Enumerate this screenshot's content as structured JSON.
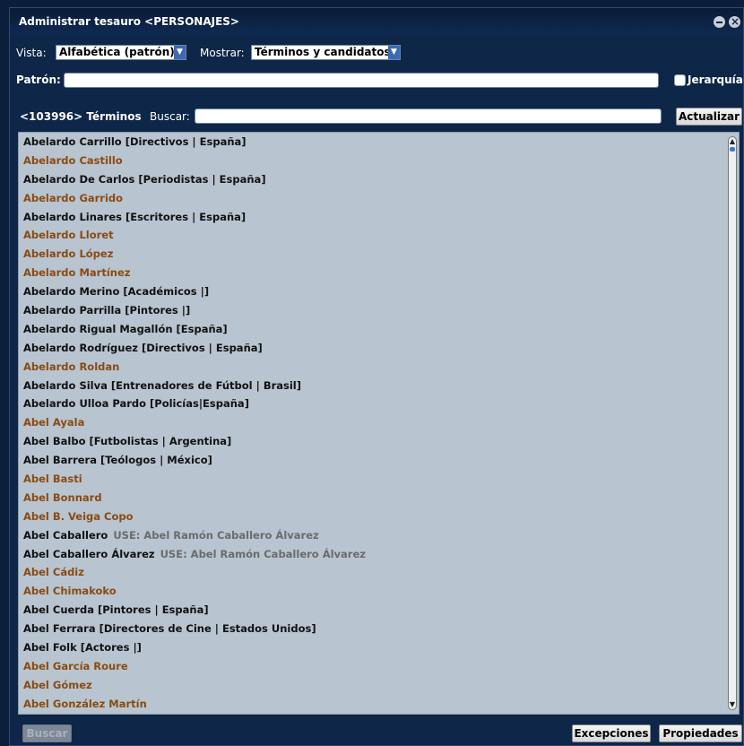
{
  "window": {
    "title": "Administrar tesauro <PERSONAJES>"
  },
  "controls": {
    "vista_label": "Vista:",
    "vista_value": "Alfabética (patrón)",
    "mostrar_label": "Mostrar:",
    "mostrar_value": "Términos y candidatos",
    "patron_label": "Patrón:",
    "patron_value": "",
    "jerarquia_label": "Jerarquía",
    "count_label": "<103996> Términos",
    "buscar_label": "Buscar:",
    "buscar_value": "",
    "actualizar": "Actualizar"
  },
  "terms": [
    {
      "text": "Abelardo Carrillo [Directivos | España]",
      "kind": "term",
      "use": ""
    },
    {
      "text": "Abelardo Castillo",
      "kind": "cand",
      "use": ""
    },
    {
      "text": "Abelardo De Carlos [Periodistas | España]",
      "kind": "term",
      "use": ""
    },
    {
      "text": "Abelardo Garrido",
      "kind": "cand",
      "use": ""
    },
    {
      "text": "Abelardo Linares [Escritores | España]",
      "kind": "term",
      "use": ""
    },
    {
      "text": "Abelardo Lloret",
      "kind": "cand",
      "use": ""
    },
    {
      "text": "Abelardo López",
      "kind": "cand",
      "use": ""
    },
    {
      "text": "Abelardo Martínez",
      "kind": "cand",
      "use": ""
    },
    {
      "text": "Abelardo Merino [Académicos |]",
      "kind": "term",
      "use": ""
    },
    {
      "text": "Abelardo Parrilla [Pintores |]",
      "kind": "term",
      "use": ""
    },
    {
      "text": "Abelardo Rigual Magallón [España]",
      "kind": "term",
      "use": ""
    },
    {
      "text": "Abelardo Rodríguez [Directivos | España]",
      "kind": "term",
      "use": ""
    },
    {
      "text": "Abelardo Roldan",
      "kind": "cand",
      "use": ""
    },
    {
      "text": "Abelardo Silva [Entrenadores de Fútbol | Brasil]",
      "kind": "term",
      "use": ""
    },
    {
      "text": "Abelardo Ulloa Pardo [Policías|España]",
      "kind": "term",
      "use": ""
    },
    {
      "text": "Abel Ayala",
      "kind": "cand",
      "use": ""
    },
    {
      "text": "Abel Balbo [Futbolistas | Argentina]",
      "kind": "term",
      "use": ""
    },
    {
      "text": "Abel Barrera [Teólogos | México]",
      "kind": "term",
      "use": ""
    },
    {
      "text": "Abel Basti",
      "kind": "cand",
      "use": ""
    },
    {
      "text": "Abel Bonnard",
      "kind": "cand",
      "use": ""
    },
    {
      "text": "Abel B. Veiga Copo",
      "kind": "cand",
      "use": ""
    },
    {
      "text": "Abel Caballero",
      "kind": "term",
      "use": "USE: Abel Ramón Caballero Álvarez"
    },
    {
      "text": "Abel Caballero Álvarez",
      "kind": "term",
      "use": "USE: Abel Ramón Caballero Álvarez"
    },
    {
      "text": "Abel Cádiz",
      "kind": "cand",
      "use": ""
    },
    {
      "text": "Abel Chimakoko",
      "kind": "cand",
      "use": ""
    },
    {
      "text": "Abel Cuerda [Pintores | España]",
      "kind": "term",
      "use": ""
    },
    {
      "text": "Abel Ferrara [Directores de Cine | Estados Unidos]",
      "kind": "term",
      "use": ""
    },
    {
      "text": "Abel Folk [Actores |]",
      "kind": "term",
      "use": ""
    },
    {
      "text": "Abel García Roure",
      "kind": "cand",
      "use": ""
    },
    {
      "text": "Abel Gómez",
      "kind": "cand",
      "use": ""
    },
    {
      "text": "Abel González Martín",
      "kind": "cand",
      "use": ""
    }
  ],
  "footer": {
    "buscar": "Buscar",
    "excepciones": "Excepciones",
    "propiedades": "Propiedades"
  },
  "colors": {
    "term": "#111111",
    "candidate": "#8a4b12",
    "use_ref": "#6b6b6b",
    "list_bg": "#b8c4cf",
    "window_bg": "#0e2647"
  }
}
